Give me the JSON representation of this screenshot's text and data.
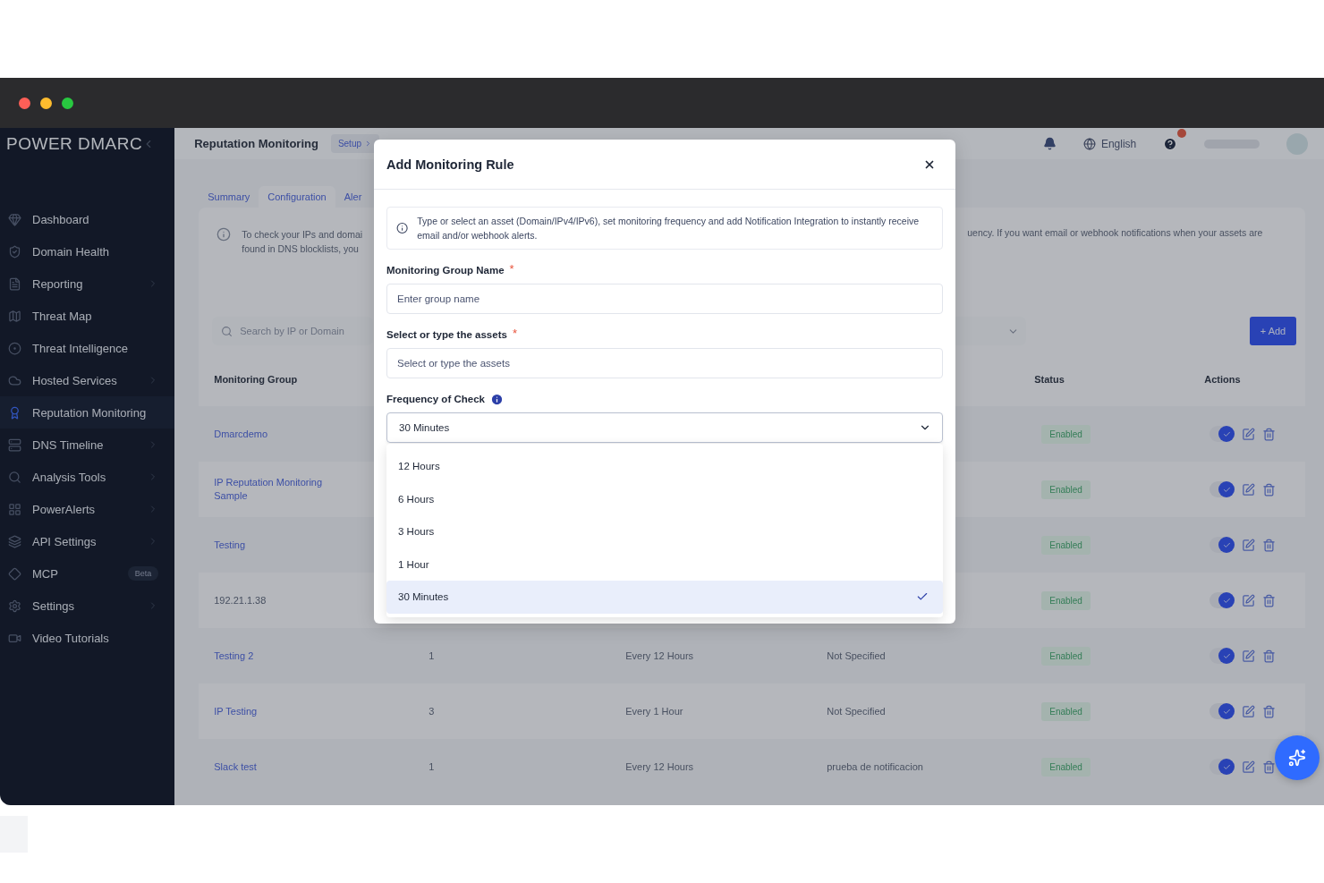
{
  "sidebar": {
    "logo": "POWER DMARC",
    "items": [
      {
        "label": "Dashboard",
        "selected": false,
        "submenu": false
      },
      {
        "label": "Domain Health",
        "selected": false,
        "submenu": false
      },
      {
        "label": "Reporting",
        "selected": false,
        "submenu": true
      },
      {
        "label": "Threat Map",
        "selected": false,
        "submenu": false
      },
      {
        "label": "Threat Intelligence",
        "selected": false,
        "submenu": false
      },
      {
        "label": "Hosted Services",
        "selected": false,
        "submenu": true
      },
      {
        "label": "Reputation Monitoring",
        "selected": true,
        "submenu": false
      },
      {
        "label": "DNS Timeline",
        "selected": false,
        "submenu": true
      },
      {
        "label": "Analysis Tools",
        "selected": false,
        "submenu": true
      },
      {
        "label": "PowerAlerts",
        "selected": false,
        "submenu": true
      },
      {
        "label": "API Settings",
        "selected": false,
        "submenu": true
      },
      {
        "label": "MCP",
        "selected": false,
        "submenu": false,
        "badge": "Beta"
      },
      {
        "label": "Settings",
        "selected": false,
        "submenu": true
      },
      {
        "label": "Video Tutorials",
        "selected": false,
        "submenu": false
      }
    ]
  },
  "header": {
    "title": "Reputation Monitoring",
    "breadcrumb": "Setup",
    "language": "English"
  },
  "tabs": [
    {
      "label": "Summary",
      "selected": false
    },
    {
      "label": "Configuration",
      "selected": true
    },
    {
      "label": "Aler",
      "selected": false
    }
  ],
  "info": {
    "left_lines": [
      "To check your IPs and domai",
      "found in DNS blocklists, you"
    ],
    "right_line": "uency. If you want email or webhook notifications when your assets are"
  },
  "search": {
    "placeholder": "Search by IP or Domain"
  },
  "add_button": "+ Add",
  "table": {
    "headers": {
      "group": "Monitoring Group",
      "status": "Status",
      "actions": "Actions"
    },
    "rows": [
      {
        "group": "Dmarcdemo",
        "link": true,
        "status": "Enabled",
        "enabled": true
      },
      {
        "group": "IP Reputation Monitoring Sample",
        "link": true,
        "status": "Enabled",
        "enabled": true
      },
      {
        "group": "Testing",
        "link": true,
        "status": "Enabled",
        "enabled": true
      },
      {
        "group": "192.21.1.38",
        "link": false,
        "status": "Enabled",
        "enabled": true
      },
      {
        "group": "Testing 2",
        "link": true,
        "assets": "1",
        "frequency": "Every 12 Hours",
        "notification": "Not Specified",
        "status": "Enabled",
        "enabled": true
      },
      {
        "group": "IP Testing",
        "link": true,
        "assets": "3",
        "frequency": "Every 1 Hour",
        "notification": "Not Specified",
        "status": "Enabled",
        "enabled": true
      },
      {
        "group": "Slack test",
        "link": true,
        "assets": "1",
        "frequency": "Every 12 Hours",
        "notification": "prueba de notificacion",
        "status": "Enabled",
        "enabled": true
      }
    ]
  },
  "modal": {
    "title": "Add Monitoring Rule",
    "info": "Type or select an asset (Domain/IPv4/IPv6), set monitoring frequency and add Notification Integration to instantly receive email and/or webhook alerts.",
    "fields": [
      {
        "label": "Monitoring Group Name",
        "required_mark": "*",
        "placeholder": "Enter group name"
      },
      {
        "label": "Select or type the assets",
        "required_mark": "*",
        "placeholder": "Select or type the assets"
      }
    ],
    "frequency": {
      "label": "Frequency of Check",
      "value": "30 Minutes",
      "expanded": true,
      "options": [
        {
          "label": "12 Hours",
          "selected": false
        },
        {
          "label": "6 Hours",
          "selected": false
        },
        {
          "label": "3 Hours",
          "selected": false
        },
        {
          "label": "1 Hour",
          "selected": false
        },
        {
          "label": "30 Minutes",
          "selected": true
        }
      ]
    }
  }
}
